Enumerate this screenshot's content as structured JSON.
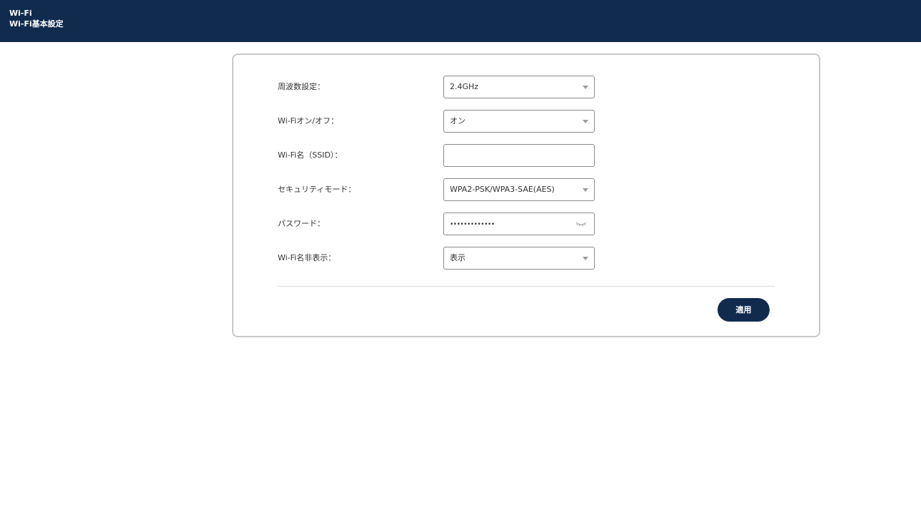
{
  "header": {
    "breadcrumb_parent": "Wi-Fi",
    "page_title": "Wi-Fi基本設定",
    "background_color": "#112b4e"
  },
  "form": {
    "frequency": {
      "label": "周波数設定：",
      "value": "2.4GHz"
    },
    "wifi_onoff": {
      "label": "Wi-Fiオン/オフ：",
      "value": "オン"
    },
    "ssid": {
      "label": "Wi-Fi名（SSID）：",
      "value": ""
    },
    "security_mode": {
      "label": "セキュリティモード：",
      "value": "WPA2-PSK/WPA3-SAE(AES)"
    },
    "password": {
      "label": "パスワード：",
      "masked_value": "•••••••••••••",
      "visibility_icon": "eye-closed-icon"
    },
    "hide_ssid": {
      "label": "Wi-Fi名非表示：",
      "value": "表示"
    }
  },
  "actions": {
    "apply_label": "適用",
    "accent_color": "#112b4e"
  }
}
